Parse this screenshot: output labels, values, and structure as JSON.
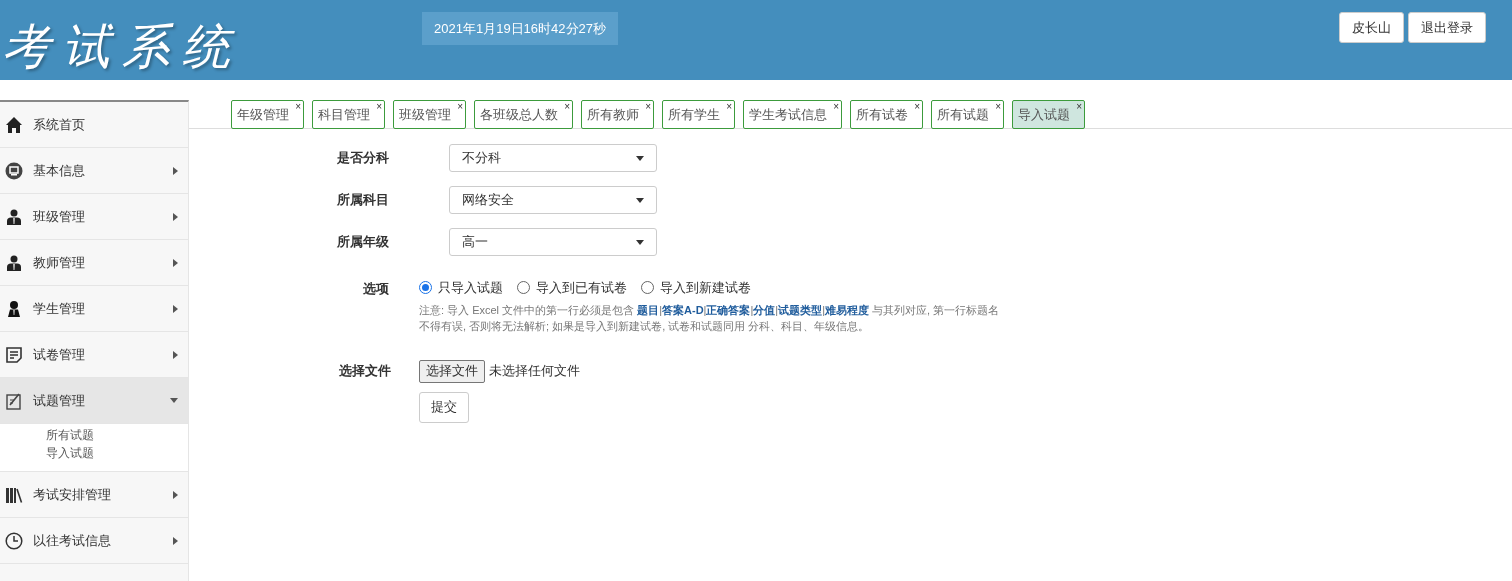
{
  "header": {
    "title": "考试系统",
    "datetime": "2021年1月19日16时42分27秒",
    "buttons": [
      "皮长山",
      "退出登录"
    ]
  },
  "sidebar": {
    "items": [
      {
        "label": "系统首页",
        "has_submenu": false,
        "expanded": false
      },
      {
        "label": "基本信息",
        "has_submenu": true,
        "expanded": false
      },
      {
        "label": "班级管理",
        "has_submenu": true,
        "expanded": false
      },
      {
        "label": "教师管理",
        "has_submenu": true,
        "expanded": false
      },
      {
        "label": "学生管理",
        "has_submenu": true,
        "expanded": false
      },
      {
        "label": "试卷管理",
        "has_submenu": true,
        "expanded": false
      },
      {
        "label": "试题管理",
        "has_submenu": true,
        "expanded": true,
        "children": [
          {
            "label": "所有试题"
          },
          {
            "label": "导入试题"
          }
        ]
      },
      {
        "label": "考试安排管理",
        "has_submenu": true,
        "expanded": false
      },
      {
        "label": "以往考试信息",
        "has_submenu": true,
        "expanded": false
      }
    ]
  },
  "tabs": [
    {
      "label": "年级管理",
      "close": "×",
      "selected": false
    },
    {
      "label": "科目管理",
      "close": "×",
      "selected": false
    },
    {
      "label": "班级管理",
      "close": "×",
      "selected": false
    },
    {
      "label": "各班级总人数",
      "close": "×",
      "selected": false
    },
    {
      "label": "所有教师",
      "close": "×",
      "selected": false
    },
    {
      "label": "所有学生",
      "close": "×",
      "selected": false
    },
    {
      "label": "学生考试信息",
      "close": "×",
      "selected": false
    },
    {
      "label": "所有试卷",
      "close": "×",
      "selected": false
    },
    {
      "label": "所有试题",
      "close": "×",
      "selected": false
    },
    {
      "label": "导入试题",
      "close": "×",
      "selected": true
    }
  ],
  "form": {
    "selects": [
      {
        "label": "是否分科",
        "value": "不分科"
      },
      {
        "label": "所属科目",
        "value": "网络安全"
      },
      {
        "label": "所属年级",
        "value": "高一"
      }
    ],
    "options": {
      "label": "选项",
      "choices": [
        {
          "label": "只导入试题",
          "selected": true
        },
        {
          "label": "导入到已有试卷",
          "selected": false
        },
        {
          "label": "导入到新建试卷",
          "selected": false
        }
      ],
      "note": "注意: 导入 Excel 文件中的第一行必须是包含 **题目**|**答案A-D**|**正确答案**|**分值**|**试题类型**|**难易程度** 与其列对应, 第一行标题名不得有误, 否则将无法解析; 如果是导入到新建试卷, 试卷和试题同用 分科、科目、年级信息。"
    },
    "file": {
      "label": "选择文件",
      "button": "选择文件",
      "status": "未选择任何文件"
    },
    "submit": "提交"
  }
}
